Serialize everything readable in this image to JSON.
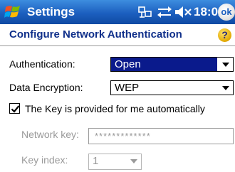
{
  "titlebar": {
    "title": "Settings",
    "time": "18:02",
    "ok_label": "ok"
  },
  "header": {
    "title": "Configure Network Authentication",
    "help_label": "?"
  },
  "form": {
    "authentication": {
      "label": "Authentication:",
      "value": "Open"
    },
    "encryption": {
      "label": "Data Encryption:",
      "value": "WEP"
    },
    "auto_key": {
      "label": "The Key is provided for me automatically",
      "checked": true
    },
    "network_key": {
      "label": "Network key:",
      "value": "*************"
    },
    "key_index": {
      "label": "Key index:",
      "value": "1"
    }
  },
  "colors": {
    "titlebar": "#1c5fbf",
    "header_text": "#0f2f8a",
    "selection": "#0a1a8c",
    "disabled_text": "#9a9a9a"
  },
  "icons": [
    "windows-logo-icon",
    "connectivity-icon",
    "sync-icon",
    "volume-muted-icon",
    "help-icon",
    "checkmark-icon"
  ]
}
